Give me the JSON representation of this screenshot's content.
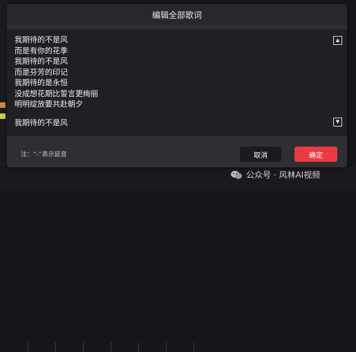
{
  "dialog": {
    "title": "编辑全部歌词",
    "lyrics": [
      "我期待的不是风",
      "而是有你的花季",
      "我期待的不是风",
      "而是芬芳的印记",
      "我期待的是永恒",
      "没成想花期比誓言更绚丽",
      "明明绽放要共赴朝夕"
    ],
    "lyric_tail": "我期待的不是风",
    "scroll_up_icon": "triangle-up-icon",
    "scroll_down_icon": "triangle-down-icon",
    "note": "注：“-”表示延音",
    "cancel_label": "取消",
    "ok_label": "确定"
  },
  "watermark": {
    "text": "公众号 · 风林AI视频",
    "icon": "wechat-icon"
  },
  "colors": {
    "dialog_bg": "#2d2f34",
    "lyrics_bg": "#1e2024",
    "ok_button": "#ea3a43",
    "cancel_button": "#1a1b1f"
  }
}
